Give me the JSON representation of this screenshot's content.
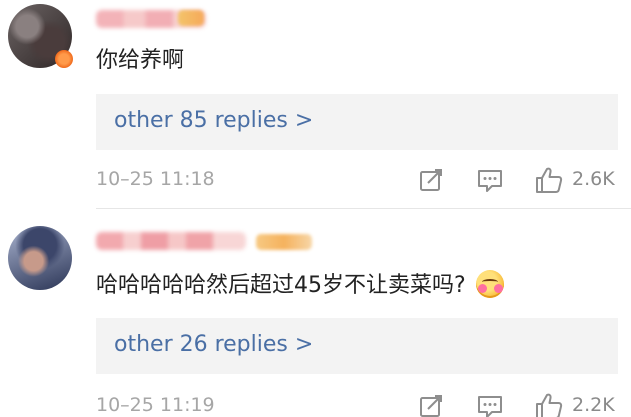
{
  "comments": [
    {
      "text": "你给养啊",
      "replies_label": "other 85 replies >",
      "timestamp": "10–25 11:18",
      "like_count": "2.6K",
      "icons": [
        "share-icon",
        "comment-icon",
        "like-icon"
      ]
    },
    {
      "text": "哈哈哈哈哈然后超过45岁不让卖菜吗?",
      "replies_label": "other 26 replies >",
      "timestamp": "10–25 11:19",
      "like_count": "2.2K",
      "icons": [
        "share-icon",
        "comment-icon",
        "like-icon"
      ]
    }
  ],
  "colors": {
    "link": "#4a6fa5",
    "meta": "#a6a6a6",
    "reply_box": "#f3f3f3"
  }
}
